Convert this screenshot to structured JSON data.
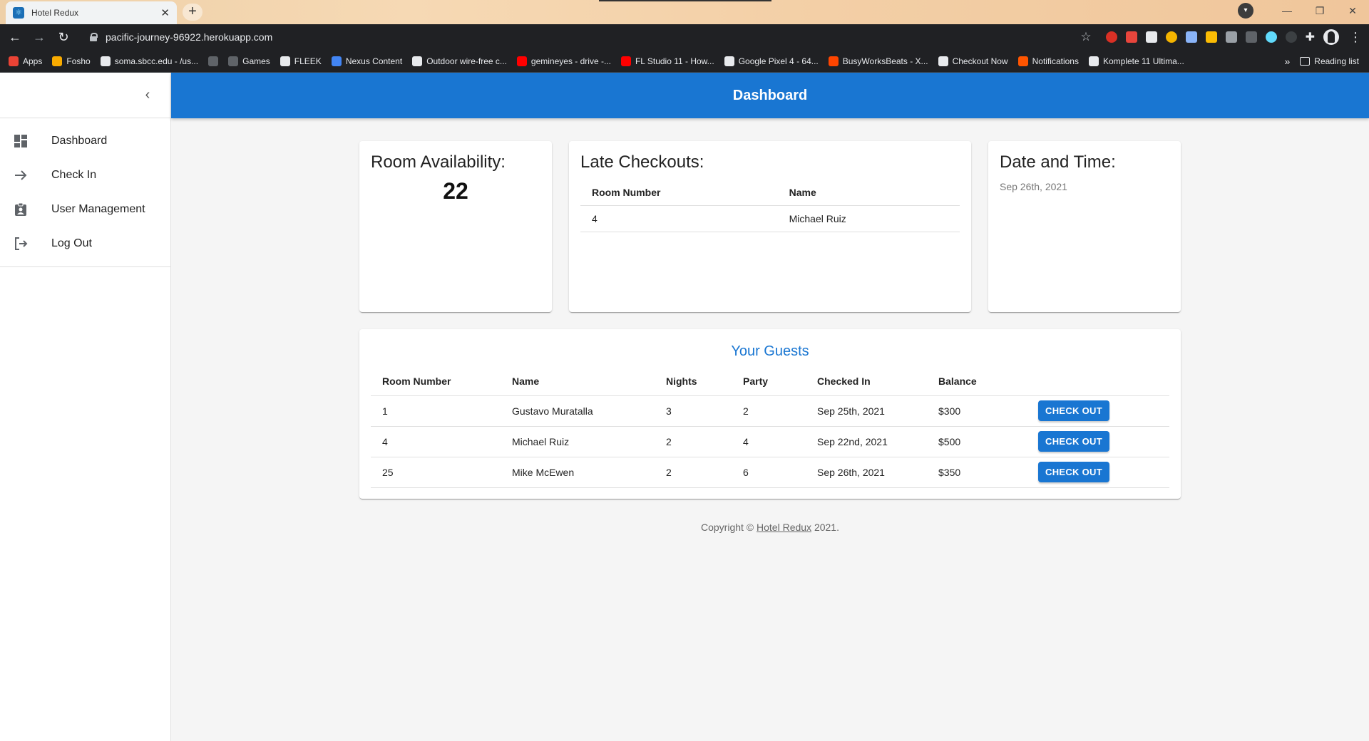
{
  "browser": {
    "tab_title": "Hotel Redux",
    "url": "pacific-journey-96922.herokuapp.com",
    "bookmarks": [
      {
        "label": "Apps",
        "color": "#ea4335"
      },
      {
        "label": "Fosho",
        "color": "#f9ab00"
      },
      {
        "label": "soma.sbcc.edu - /us...",
        "color": "#e8eaed"
      },
      {
        "label": "",
        "color": "#5f6368"
      },
      {
        "label": "Games",
        "color": "#5f6368"
      },
      {
        "label": "FLEEK",
        "color": "#e8eaed"
      },
      {
        "label": "Nexus Content",
        "color": "#4285f4"
      },
      {
        "label": "Outdoor wire-free c...",
        "color": "#e8eaed"
      },
      {
        "label": "gemineyes - drive -...",
        "color": "#ff0000"
      },
      {
        "label": "FL Studio 11 - How...",
        "color": "#ff0000"
      },
      {
        "label": "Google Pixel 4 - 64...",
        "color": "#e8eaed"
      },
      {
        "label": "BusyWorksBeats - X...",
        "color": "#ff4500"
      },
      {
        "label": "Checkout Now",
        "color": "#e8eaed"
      },
      {
        "label": "Notifications",
        "color": "#ff5500"
      },
      {
        "label": "Komplete 11 Ultima...",
        "color": "#e8eaed"
      }
    ],
    "more_label": "»",
    "reading_list": "Reading list"
  },
  "sidebar": {
    "items": [
      {
        "label": "Dashboard",
        "icon": "dashboard-icon"
      },
      {
        "label": "Check In",
        "icon": "arrow-right-icon"
      },
      {
        "label": "User Management",
        "icon": "badge-icon"
      },
      {
        "label": "Log Out",
        "icon": "logout-icon"
      }
    ]
  },
  "appbar": {
    "title": "Dashboard"
  },
  "room_availability": {
    "title": "Room Availability:",
    "value": "22"
  },
  "late_checkouts": {
    "title": "Late Checkouts:",
    "columns": [
      "Room Number",
      "Name"
    ],
    "rows": [
      [
        "4",
        "Michael Ruiz"
      ]
    ]
  },
  "date_time": {
    "title": "Date and Time:",
    "value": "Sep 26th, 2021"
  },
  "guests": {
    "title": "Your Guests",
    "columns": [
      "Room Number",
      "Name",
      "Nights",
      "Party",
      "Checked In",
      "Balance",
      ""
    ],
    "rows": [
      {
        "room": "1",
        "name": "Gustavo Muratalla",
        "nights": "3",
        "party": "2",
        "checked_in": "Sep 25th, 2021",
        "balance": "$300",
        "action": "CHECK OUT"
      },
      {
        "room": "4",
        "name": "Michael Ruiz",
        "nights": "2",
        "party": "4",
        "checked_in": "Sep 22nd, 2021",
        "balance": "$500",
        "action": "CHECK OUT"
      },
      {
        "room": "25",
        "name": "Mike McEwen",
        "nights": "2",
        "party": "6",
        "checked_in": "Sep 26th, 2021",
        "balance": "$350",
        "action": "CHECK OUT"
      }
    ]
  },
  "footer": {
    "prefix": "Copyright © ",
    "link": "Hotel Redux",
    "suffix": " 2021."
  },
  "colors": {
    "primary": "#1976d2",
    "background": "#f5f5f5"
  }
}
